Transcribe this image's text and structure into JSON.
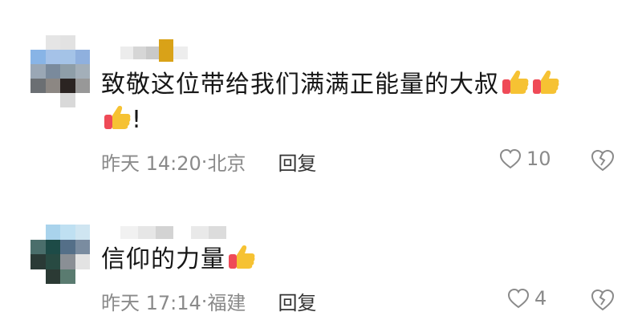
{
  "comments": [
    {
      "text": "致敬这位带给我们满满正能量的大叔",
      "text_tail": "!",
      "thumb_emojis_inline": 2,
      "timestamp": "昨天 14:20",
      "separator": "·",
      "location": "北京",
      "reply_label": "回复",
      "like_count": "10"
    },
    {
      "text": "信仰的力量",
      "timestamp": "昨天 17:14",
      "separator": "·",
      "location": "福建",
      "reply_label": "回复",
      "like_count": "4"
    }
  ],
  "icons": {
    "thumb": "thumbs-up-emoji",
    "like": "heart-outline-icon",
    "dislike": "broken-heart-outline-icon"
  },
  "colors": {
    "text": "#161616",
    "meta": "#8a8a8a",
    "reply": "#333333",
    "thumb_hand": "#f6c233",
    "thumb_cuff": "#ef4a57"
  }
}
